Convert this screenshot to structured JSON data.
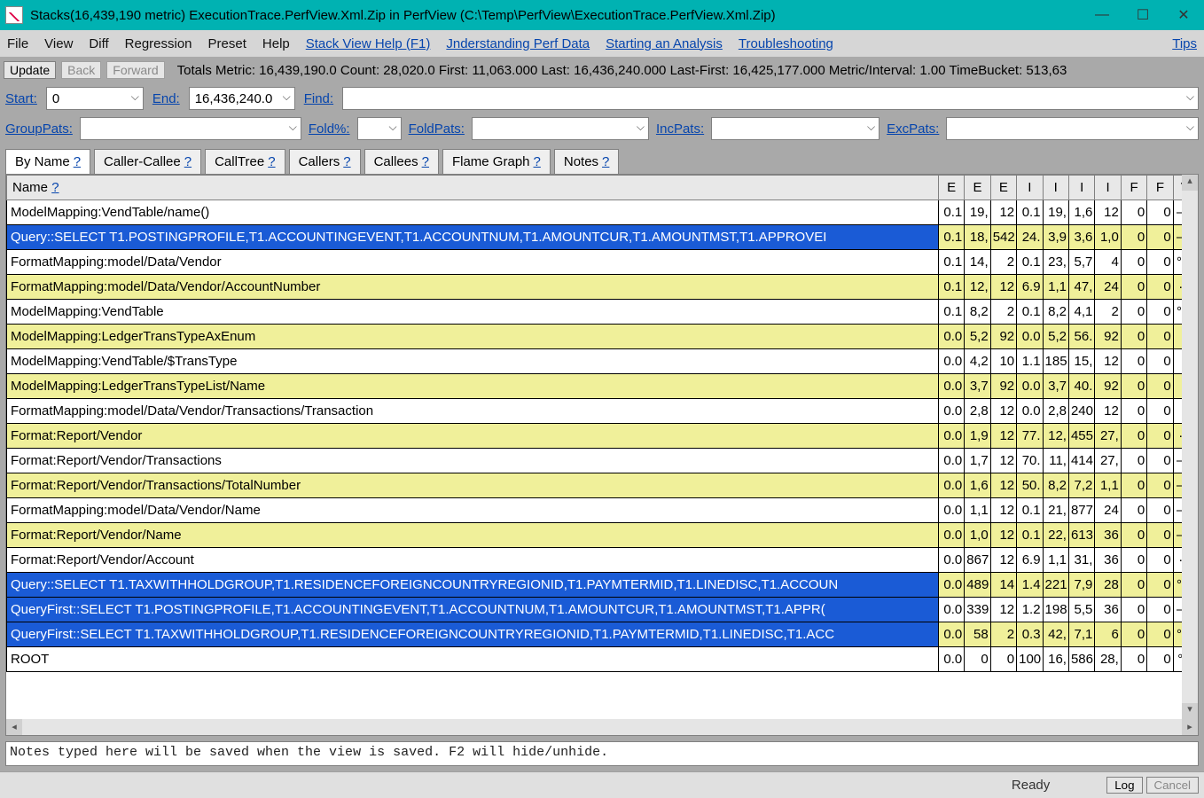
{
  "window": {
    "title": "Stacks(16,439,190 metric) ExecutionTrace.PerfView.Xml.Zip in PerfView (C:\\Temp\\PerfView\\ExecutionTrace.PerfView.Xml.Zip)"
  },
  "menu": {
    "file": "File",
    "view": "View",
    "diff": "Diff",
    "regression": "Regression",
    "preset": "Preset",
    "help": "Help",
    "link_stackhelp": "Stack View Help (F1)",
    "link_understanding": "Jnderstanding Perf Data",
    "link_analysis": "Starting an Analysis",
    "link_troubleshoot": "Troubleshooting",
    "link_tips": "Tips"
  },
  "toolbar1": {
    "update": "Update",
    "back": "Back",
    "forward": "Forward",
    "stats": "Totals Metric: 16,439,190.0   Count: 28,020.0   First: 11,063.000 Last: 16,436,240.000   Last-First: 16,425,177.000   Metric/Interval: 1.00   TimeBucket: 513,63"
  },
  "toolbar2": {
    "start_lbl": "Start:",
    "start_val": "0",
    "end_lbl": "End:",
    "end_val": "16,436,240.0",
    "find_lbl": "Find:",
    "find_val": ""
  },
  "toolbar3": {
    "grouppats_lbl": "GroupPats:",
    "grouppats_val": "",
    "foldpct_lbl": "Fold%:",
    "foldpct_val": "",
    "foldpats_lbl": "FoldPats:",
    "foldpats_val": "",
    "incpats_lbl": "IncPats:",
    "incpats_val": "",
    "excpats_lbl": "ExcPats:",
    "excpats_val": ""
  },
  "tabs": {
    "byname": "By Name",
    "callercallee": "Caller-Callee",
    "calltree": "CallTree",
    "callers": "Callers",
    "callees": "Callees",
    "flame": "Flame Graph",
    "notes": "Notes",
    "q": "?"
  },
  "table": {
    "name_header": "Name",
    "name_q": "?",
    "cols": [
      "E",
      "E",
      "E",
      "I",
      "I",
      "I",
      "I",
      "F",
      "F",
      "V"
    ],
    "rows": [
      {
        "name": "ModelMapping:VendTable/name()",
        "c": [
          "0.1",
          "19,",
          "12",
          "0.1",
          "19,",
          "1,6",
          "12",
          "0",
          "0",
          "—°"
        ],
        "striped": false,
        "sel": false
      },
      {
        "name": "Query::SELECT T1.POSTINGPROFILE,T1.ACCOUNTINGEVENT,T1.ACCOUNTNUM,T1.AMOUNTCUR,T1.AMOUNTMST,T1.APPROVEI",
        "c": [
          "0.1",
          "18,",
          "542",
          "24.",
          "3,9",
          "3,6",
          "1,0",
          "0",
          "0",
          "—°"
        ],
        "striped": true,
        "sel": true
      },
      {
        "name": "FormatMapping:model/Data/Vendor",
        "c": [
          "0.1",
          "14,",
          "2",
          "0.1",
          "23,",
          "5,7",
          "4",
          "0",
          "0",
          "°—"
        ],
        "striped": false,
        "sel": false
      },
      {
        "name": "FormatMapping:model/Data/Vendor/AccountNumber",
        "c": [
          "0.1",
          "12,",
          "12",
          "6.9",
          "1,1",
          "47,",
          "24",
          "0",
          "0",
          "·–⁷"
        ],
        "striped": true,
        "sel": false
      },
      {
        "name": "ModelMapping:VendTable",
        "c": [
          "0.1",
          "8,2",
          "2",
          "0.1",
          "8,2",
          "4,1",
          "2",
          "0",
          "0",
          "°—"
        ],
        "striped": false,
        "sel": false
      },
      {
        "name": "ModelMapping:LedgerTransTypeAxEnum",
        "c": [
          "0.0",
          "5,2",
          "92",
          "0.0",
          "5,2",
          "56.",
          "92",
          "0",
          "0",
          "—"
        ],
        "striped": true,
        "sel": false
      },
      {
        "name": "ModelMapping:VendTable/$TransType",
        "c": [
          "0.0",
          "4,2",
          "10",
          "1.1",
          "185",
          "15,",
          "12",
          "0",
          "0",
          "—"
        ],
        "striped": false,
        "sel": false
      },
      {
        "name": "ModelMapping:LedgerTransTypeList/Name",
        "c": [
          "0.0",
          "3,7",
          "92",
          "0.0",
          "3,7",
          "40.",
          "92",
          "0",
          "0",
          "—"
        ],
        "striped": true,
        "sel": false
      },
      {
        "name": "FormatMapping:model/Data/Vendor/Transactions/Transaction",
        "c": [
          "0.0",
          "2,8",
          "12",
          "0.0",
          "2,8",
          "240",
          "12",
          "0",
          "0",
          "—"
        ],
        "striped": false,
        "sel": false
      },
      {
        "name": "Format:Report/Vendor",
        "c": [
          "0.0",
          "1,9",
          "12",
          "77.",
          "12,",
          "455",
          "27,",
          "0",
          "0",
          "·–⁷"
        ],
        "striped": true,
        "sel": false
      },
      {
        "name": "Format:Report/Vendor/Transactions",
        "c": [
          "0.0",
          "1,7",
          "12",
          "70.",
          "11,",
          "414",
          "27,",
          "0",
          "0",
          "—°"
        ],
        "striped": false,
        "sel": false
      },
      {
        "name": "Format:Report/Vendor/Transactions/TotalNumber",
        "c": [
          "0.0",
          "1,6",
          "12",
          "50.",
          "8,2",
          "7,2",
          "1,1",
          "0",
          "0",
          "—°"
        ],
        "striped": true,
        "sel": false
      },
      {
        "name": "FormatMapping:model/Data/Vendor/Name",
        "c": [
          "0.0",
          "1,1",
          "12",
          "0.1",
          "21,",
          "877",
          "24",
          "0",
          "0",
          "—°"
        ],
        "striped": false,
        "sel": false
      },
      {
        "name": "Format:Report/Vendor/Name",
        "c": [
          "0.0",
          "1,0",
          "12",
          "0.1",
          "22,",
          "613",
          "36",
          "0",
          "0",
          "—°"
        ],
        "striped": true,
        "sel": false
      },
      {
        "name": "Format:Report/Vendor/Account",
        "c": [
          "0.0",
          "867",
          "12",
          "6.9",
          "1,1",
          "31,",
          "36",
          "0",
          "0",
          "·–⁷"
        ],
        "striped": false,
        "sel": false
      },
      {
        "name": "Query::SELECT T1.TAXWITHHOLDGROUP,T1.RESIDENCEFOREIGNCOUNTRYREGIONID,T1.PAYMTERMID,T1.LINEDISC,T1.ACCOUN",
        "c": [
          "0.0",
          "489",
          "14",
          "1.4",
          "221",
          "7,9",
          "28",
          "0",
          "0",
          "°—"
        ],
        "striped": true,
        "sel": true
      },
      {
        "name": "QueryFirst::SELECT T1.POSTINGPROFILE,T1.ACCOUNTINGEVENT,T1.ACCOUNTNUM,T1.AMOUNTCUR,T1.AMOUNTMST,T1.APPR(",
        "c": [
          "0.0",
          "339",
          "12",
          "1.2",
          "198",
          "5,5",
          "36",
          "0",
          "0",
          "—°"
        ],
        "striped": false,
        "sel": true
      },
      {
        "name": "QueryFirst::SELECT T1.TAXWITHHOLDGROUP,T1.RESIDENCEFOREIGNCOUNTRYREGIONID,T1.PAYMTERMID,T1.LINEDISC,T1.ACC",
        "c": [
          "0.0",
          "58",
          "2",
          "0.3",
          "42,",
          "7,1",
          "6",
          "0",
          "0",
          "°—"
        ],
        "striped": true,
        "sel": true
      },
      {
        "name": "ROOT",
        "c": [
          "0.0",
          "0",
          "0",
          "100",
          "16,",
          "586",
          "28,",
          "0",
          "0",
          "°–⁷"
        ],
        "striped": false,
        "sel": false
      }
    ]
  },
  "notes": {
    "placeholder": "Notes typed here will be saved when the view is saved. F2 will hide/unhide."
  },
  "status": {
    "ready": "Ready",
    "log": "Log",
    "cancel": "Cancel"
  }
}
